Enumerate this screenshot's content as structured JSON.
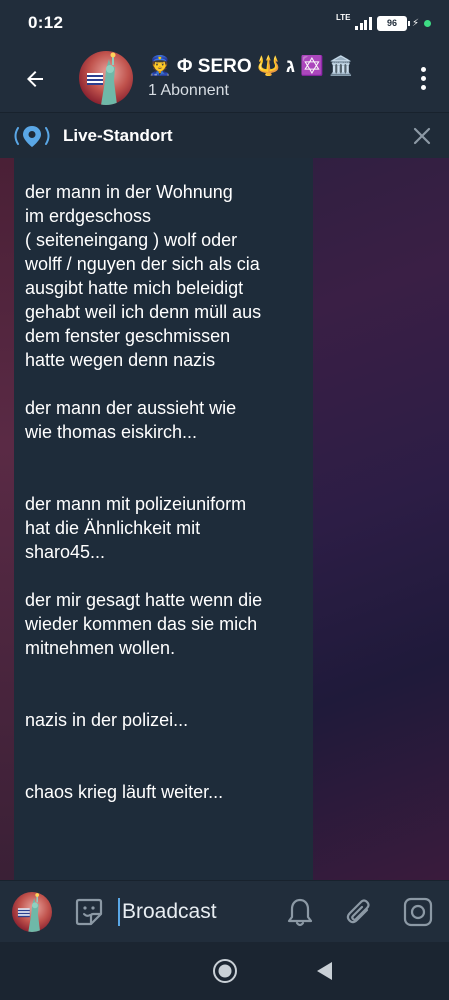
{
  "status_bar": {
    "time": "0:12",
    "network": "LTE",
    "battery": "96"
  },
  "header": {
    "title": "👮 Φ SERO 🔱 ג ✡️ 🏛️",
    "subtitle": "1 Abonnent"
  },
  "live_location": {
    "label": "Live-Standort"
  },
  "message": {
    "paragraphs": [
      "der mann in der Wohnung\nim erdgeschoss\n( seiteneingang ) wolf oder\nwolff / nguyen der sich als cia\nausgibt hatte mich beleidigt\ngehabt weil ich denn müll aus\ndem fenster geschmissen\nhatte wegen denn nazis",
      "der mann der aussieht wie\nwie thomas eiskirch...",
      "der mann mit polizeiuniform\nhat die Ähnlichkeit mit\nsharo45...",
      "der mir gesagt hatte wenn die\nwieder kommen das sie mich\nmitnehmen wollen.",
      "nazis in der polizei...",
      "chaos krieg läuft weiter..."
    ]
  },
  "input_bar": {
    "placeholder": "Broadcast"
  },
  "colors": {
    "header_bg": "#212d3b",
    "message_bg": "#1e2c3a",
    "accent": "#5aa7e6",
    "status_dot": "#3ddc84"
  },
  "icons": {
    "back": "arrow-left-icon",
    "menu": "more-vertical-icon",
    "live": "location-pin-icon",
    "close": "close-icon",
    "sticker": "sticker-icon",
    "bell": "bell-icon",
    "attach": "paperclip-icon",
    "camera": "camera-icon",
    "home": "home-circle-icon",
    "nav_back": "triangle-back-icon"
  }
}
